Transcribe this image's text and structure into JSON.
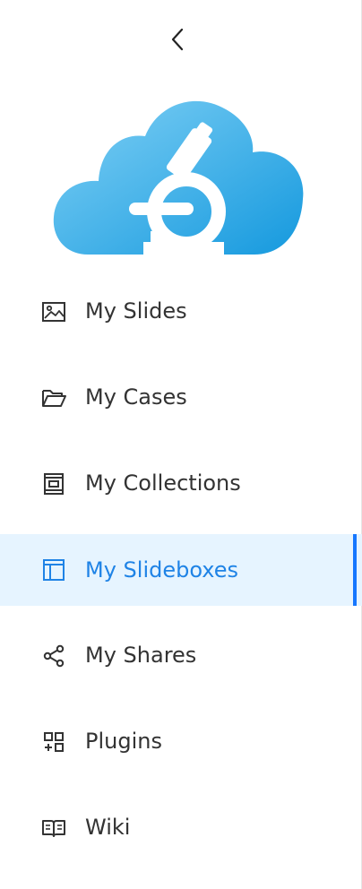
{
  "sidebar": {
    "collapse_icon": "chevron-left-icon",
    "logo_icon": "cloud-microscope-logo",
    "items": [
      {
        "label": "My Slides",
        "icon": "image-icon",
        "active": false
      },
      {
        "label": "My Cases",
        "icon": "folder-open-icon",
        "active": false
      },
      {
        "label": "My Collections",
        "icon": "collection-icon",
        "active": false
      },
      {
        "label": "My Slideboxes",
        "icon": "slidebox-icon",
        "active": true
      },
      {
        "label": "My Shares",
        "icon": "share-icon",
        "active": false
      },
      {
        "label": "Plugins",
        "icon": "plugins-icon",
        "active": false
      },
      {
        "label": "Wiki",
        "icon": "book-icon",
        "active": false
      }
    ]
  },
  "colors": {
    "accent": "#1677ff",
    "active_text": "#1f83e6",
    "active_bg": "#e6f4ff",
    "text": "#333333",
    "logo_light": "#6cc4f0",
    "logo_dark": "#159fe0"
  }
}
